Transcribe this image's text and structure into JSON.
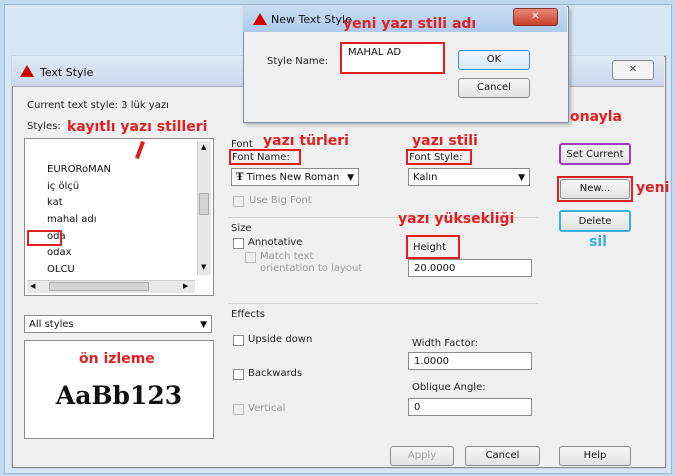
{
  "text_style_dialog": {
    "title": "Text Style",
    "close_label": "✕",
    "current_text_style": "Current text style:  3 lük yazı",
    "styles_label": "Styles:",
    "styles_list": [
      "EURORoMAN",
      "iç ölçü",
      "kat",
      "mahal adı",
      "oda",
      "odax",
      "OLCU"
    ],
    "filter_value": "All styles",
    "preview_text": "AaBb123",
    "font": {
      "section": "Font",
      "font_name_label": "Font Name:",
      "font_name_value": "Times New Roman",
      "font_style_label": "Font Style:",
      "font_style_value": "Kalın",
      "use_big_font": "Use Big Font"
    },
    "size": {
      "section": "Size",
      "annotative": "Annotative",
      "match_orientation": "Match text orientation to layout",
      "height_label": "Height",
      "height_value": "20.0000"
    },
    "effects": {
      "section": "Effects",
      "upside_down": "Upside down",
      "backwards": "Backwards",
      "vertical": "Vertical",
      "width_factor_label": "Width Factor:",
      "width_factor_value": "1.0000",
      "oblique_label": "Oblique Angle:",
      "oblique_value": "0"
    },
    "buttons": {
      "set_current": "Set Current",
      "new": "New...",
      "delete": "Delete",
      "apply": "Apply",
      "cancel": "Cancel",
      "help": "Help"
    }
  },
  "new_text_style_dialog": {
    "title": "New Text Style",
    "close_label": "✕",
    "style_name_label": "Style Name:",
    "style_name_value": "MAHAL AD",
    "ok": "OK",
    "cancel": "Cancel"
  },
  "annotations": {
    "new_style_name": "yeni yazı stili adı",
    "saved_styles": "kayıtlı yazı stilleri",
    "font_types": "yazı türleri",
    "font_style": "yazı stili",
    "confirm": "onayla",
    "new": "yeni",
    "height": "yazı yüksekliği",
    "delete": "sil",
    "preview": "ön izleme"
  },
  "colors": {
    "annotation_red": "#e02020",
    "set_current_highlight": "#9b3fb5",
    "delete_highlight": "#3ab0d8",
    "warning_icon": "#d40000"
  }
}
